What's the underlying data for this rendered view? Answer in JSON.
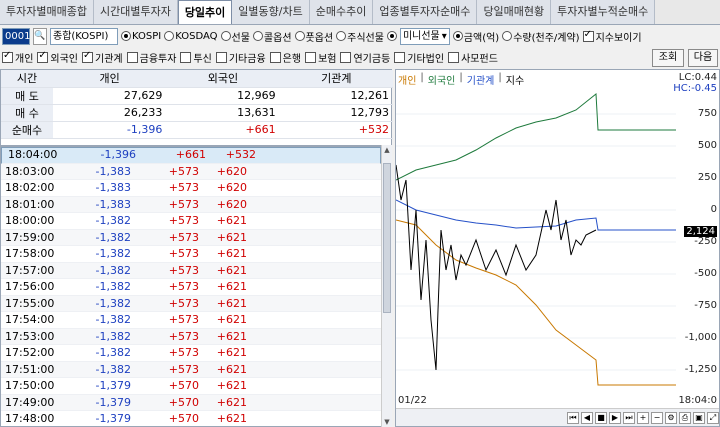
{
  "tabs": [
    "투자자별매매종합",
    "시간대별투자자",
    "당일추이",
    "일별동향/차트",
    "순매수추이",
    "업종별투자자순매수",
    "당일매매현황",
    "투자자별누적순매수"
  ],
  "active_tab": 2,
  "toolbar": {
    "code": "0001",
    "market_label": "종합(KOSPI)",
    "radios": [
      {
        "label": "KOSPI",
        "on": true
      },
      {
        "label": "KOSDAQ",
        "on": false
      },
      {
        "label": "선물",
        "on": false
      },
      {
        "label": "콜옵션",
        "on": false
      },
      {
        "label": "풋옵션",
        "on": false
      },
      {
        "label": "주식선물",
        "on": false
      },
      {
        "label": "",
        "on": true
      }
    ],
    "mini_select": "미니선물",
    "unit_radios": [
      {
        "label": "금액(억)",
        "on": true
      },
      {
        "label": "수량(천주/계약)",
        "on": false
      }
    ],
    "index_check": "지수보이기"
  },
  "filters": [
    {
      "label": "개인",
      "on": true
    },
    {
      "label": "외국인",
      "on": true
    },
    {
      "label": "기관계",
      "on": true
    },
    {
      "label": "금융투자",
      "on": false
    },
    {
      "label": "투신",
      "on": false
    },
    {
      "label": "기타금융",
      "on": false
    },
    {
      "label": "은행",
      "on": false
    },
    {
      "label": "보험",
      "on": false
    },
    {
      "label": "연기금등",
      "on": false
    },
    {
      "label": "기타법인",
      "on": false
    },
    {
      "label": "사모펀드",
      "on": false
    }
  ],
  "buttons": {
    "query": "조회",
    "next": "다음"
  },
  "summary": {
    "headers": [
      "시간",
      "개인",
      "외국인",
      "기관계"
    ],
    "rows": [
      {
        "label": "매 도",
        "a": "27,629",
        "b": "12,969",
        "c": "12,261"
      },
      {
        "label": "매 수",
        "a": "26,233",
        "b": "13,631",
        "c": "12,793"
      },
      {
        "label": "순매수",
        "a": "-1,396",
        "b": "+661",
        "c": "+532"
      }
    ]
  },
  "rows": [
    {
      "t": "18:04:00",
      "a": "-1,396",
      "b": "+661",
      "c": "+532"
    },
    {
      "t": "18:03:00",
      "a": "-1,383",
      "b": "+573",
      "c": "+620"
    },
    {
      "t": "18:02:00",
      "a": "-1,383",
      "b": "+573",
      "c": "+620"
    },
    {
      "t": "18:01:00",
      "a": "-1,383",
      "b": "+573",
      "c": "+620"
    },
    {
      "t": "18:00:00",
      "a": "-1,382",
      "b": "+573",
      "c": "+621"
    },
    {
      "t": "17:59:00",
      "a": "-1,382",
      "b": "+573",
      "c": "+621"
    },
    {
      "t": "17:58:00",
      "a": "-1,382",
      "b": "+573",
      "c": "+621"
    },
    {
      "t": "17:57:00",
      "a": "-1,382",
      "b": "+573",
      "c": "+621"
    },
    {
      "t": "17:56:00",
      "a": "-1,382",
      "b": "+573",
      "c": "+621"
    },
    {
      "t": "17:55:00",
      "a": "-1,382",
      "b": "+573",
      "c": "+621"
    },
    {
      "t": "17:54:00",
      "a": "-1,382",
      "b": "+573",
      "c": "+621"
    },
    {
      "t": "17:53:00",
      "a": "-1,382",
      "b": "+573",
      "c": "+621"
    },
    {
      "t": "17:52:00",
      "a": "-1,382",
      "b": "+573",
      "c": "+621"
    },
    {
      "t": "17:51:00",
      "a": "-1,382",
      "b": "+573",
      "c": "+621"
    },
    {
      "t": "17:50:00",
      "a": "-1,379",
      "b": "+570",
      "c": "+621"
    },
    {
      "t": "17:49:00",
      "a": "-1,379",
      "b": "+570",
      "c": "+621"
    },
    {
      "t": "17:48:00",
      "a": "-1,379",
      "b": "+570",
      "c": "+621"
    }
  ],
  "chart": {
    "legend": [
      "개인",
      "외국인",
      "기관계",
      "지수"
    ],
    "lc_label": "LC:0.44",
    "hc_label": "HC:-0.45",
    "y_ticks": [
      "750",
      "500",
      "250",
      "0",
      "-250",
      "-500",
      "-750",
      "-1,000",
      "-1,250"
    ],
    "current_index": "2,124",
    "x_start": "01/22",
    "x_end": "18:04:0",
    "colors": {
      "personal": "#c87800",
      "foreign": "#1e7a3c",
      "institution": "#2550c8",
      "index": "#000000"
    }
  }
}
